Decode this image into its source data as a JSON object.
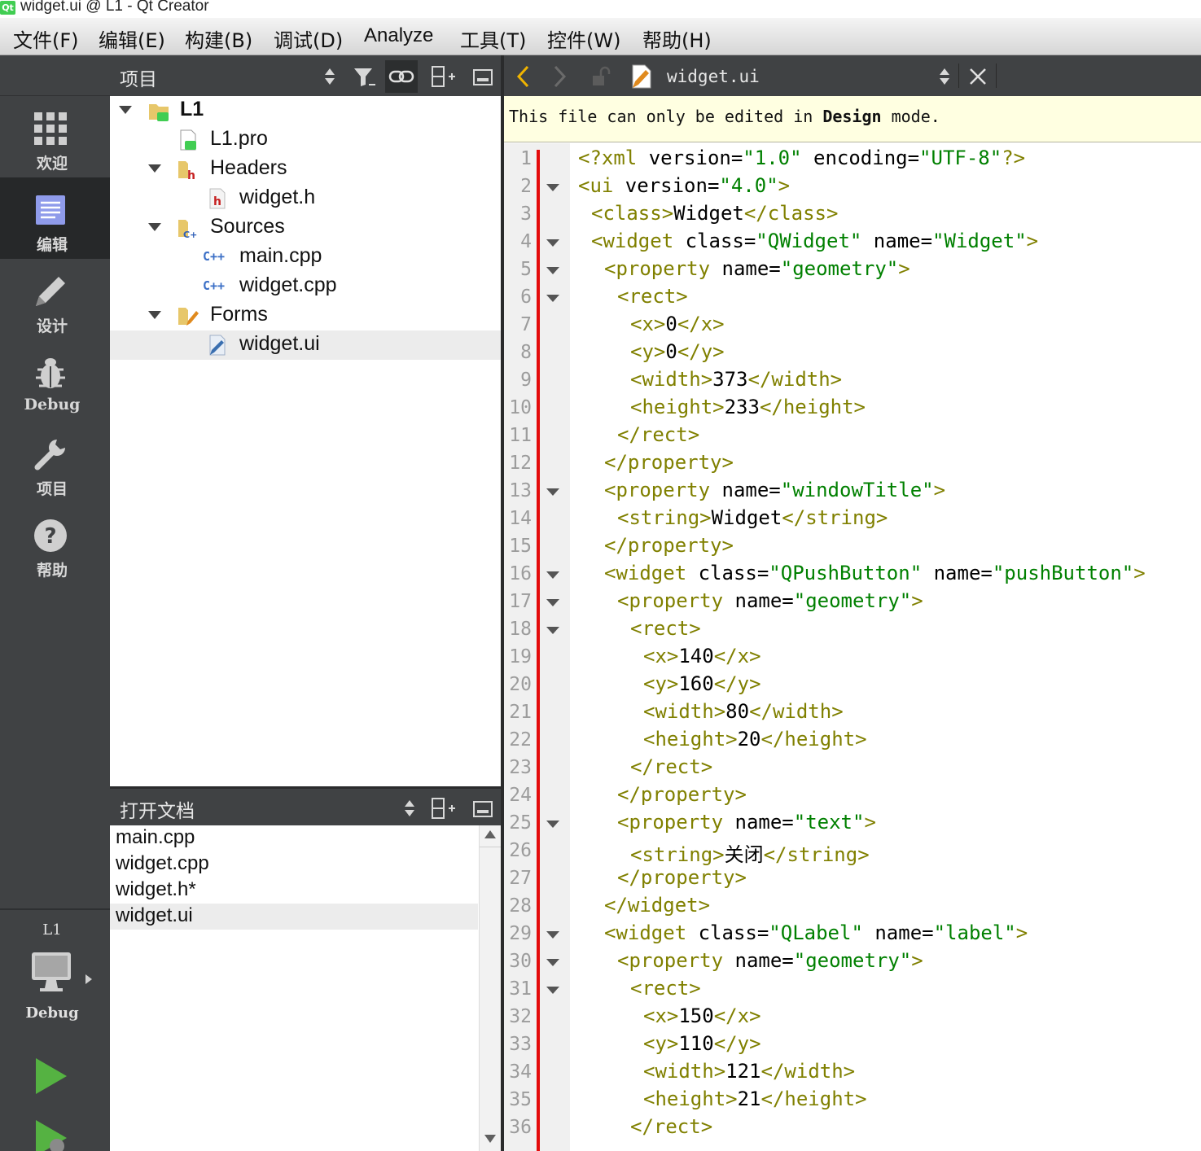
{
  "window": {
    "title": "widget.ui @ L1 - Qt Creator",
    "app_icon_label": "Qt"
  },
  "menubar": {
    "items": [
      {
        "label": "文件(F)"
      },
      {
        "label": "编辑(E)"
      },
      {
        "label": "构建(B)"
      },
      {
        "label": "调试(D)"
      },
      {
        "label": "Analyze"
      },
      {
        "label": "工具(T)"
      },
      {
        "label": "控件(W)"
      },
      {
        "label": "帮助(H)"
      }
    ]
  },
  "modebar": {
    "modes": [
      {
        "label": "欢迎",
        "icon": "grid-icon",
        "active": false
      },
      {
        "label": "编辑",
        "icon": "document-edit-icon",
        "active": true
      },
      {
        "label": "设计",
        "icon": "pencil-icon",
        "active": false
      },
      {
        "label": "Debug",
        "icon": "bug-icon",
        "active": false
      },
      {
        "label": "项目",
        "icon": "wrench-icon",
        "active": false
      },
      {
        "label": "帮助",
        "icon": "help-icon",
        "active": false
      }
    ],
    "kit": {
      "project": "L1",
      "build_mode": "Debug"
    }
  },
  "project_pane": {
    "title": "项目",
    "tree": [
      {
        "label": "L1",
        "level": 0,
        "expanded": true,
        "icon": "qt-project-folder-icon",
        "bold": true
      },
      {
        "label": "L1.pro",
        "level": 1,
        "icon": "qt-pro-file-icon"
      },
      {
        "label": "Headers",
        "level": 1,
        "expanded": true,
        "icon": "headers-folder-icon"
      },
      {
        "label": "widget.h",
        "level": 2,
        "icon": "header-file-icon"
      },
      {
        "label": "Sources",
        "level": 1,
        "expanded": true,
        "icon": "sources-folder-icon"
      },
      {
        "label": "main.cpp",
        "level": 2,
        "icon": "cpp-file-icon"
      },
      {
        "label": "widget.cpp",
        "level": 2,
        "icon": "cpp-file-icon"
      },
      {
        "label": "Forms",
        "level": 1,
        "expanded": true,
        "icon": "forms-folder-icon"
      },
      {
        "label": "widget.ui",
        "level": 2,
        "icon": "ui-file-icon",
        "selected": true
      }
    ],
    "cpp_badge": "C++"
  },
  "open_documents": {
    "title": "打开文档",
    "items": [
      {
        "label": "main.cpp"
      },
      {
        "label": "widget.cpp"
      },
      {
        "label": "widget.h*"
      },
      {
        "label": "widget.ui",
        "selected": true
      }
    ]
  },
  "editor": {
    "file_name": "widget.ui",
    "info_prefix": "This file can only be edited in ",
    "info_bold": "Design",
    "info_suffix": " mode.",
    "lines": [
      {
        "n": "1",
        "fold": false,
        "indent": 0,
        "parts": [
          [
            "tag",
            "<?xml "
          ],
          [
            "attr",
            "version="
          ],
          [
            "val",
            "\"1.0\""
          ],
          [
            "attr",
            " encoding="
          ],
          [
            "val",
            "\"UTF-8\""
          ],
          [
            "tag",
            "?>"
          ]
        ]
      },
      {
        "n": "2",
        "fold": true,
        "indent": 0,
        "parts": [
          [
            "tag",
            "<ui "
          ],
          [
            "attr",
            "version="
          ],
          [
            "val",
            "\"4.0\""
          ],
          [
            "tag",
            ">"
          ]
        ]
      },
      {
        "n": "3",
        "fold": false,
        "indent": 1,
        "parts": [
          [
            "tag",
            "<class>"
          ],
          [
            "txt",
            "Widget"
          ],
          [
            "tag",
            "</class>"
          ]
        ]
      },
      {
        "n": "4",
        "fold": true,
        "indent": 1,
        "parts": [
          [
            "tag",
            "<widget "
          ],
          [
            "attr",
            "class="
          ],
          [
            "val",
            "\"QWidget\""
          ],
          [
            "attr",
            " name="
          ],
          [
            "val",
            "\"Widget\""
          ],
          [
            "tag",
            ">"
          ]
        ]
      },
      {
        "n": "5",
        "fold": true,
        "indent": 2,
        "parts": [
          [
            "tag",
            "<property "
          ],
          [
            "attr",
            "name="
          ],
          [
            "val",
            "\"geometry\""
          ],
          [
            "tag",
            ">"
          ]
        ]
      },
      {
        "n": "6",
        "fold": true,
        "indent": 3,
        "parts": [
          [
            "tag",
            "<rect>"
          ]
        ]
      },
      {
        "n": "7",
        "fold": false,
        "indent": 4,
        "parts": [
          [
            "tag",
            "<x>"
          ],
          [
            "txt",
            "0"
          ],
          [
            "tag",
            "</x>"
          ]
        ]
      },
      {
        "n": "8",
        "fold": false,
        "indent": 4,
        "parts": [
          [
            "tag",
            "<y>"
          ],
          [
            "txt",
            "0"
          ],
          [
            "tag",
            "</y>"
          ]
        ]
      },
      {
        "n": "9",
        "fold": false,
        "indent": 4,
        "parts": [
          [
            "tag",
            "<width>"
          ],
          [
            "txt",
            "373"
          ],
          [
            "tag",
            "</width>"
          ]
        ]
      },
      {
        "n": "10",
        "fold": false,
        "indent": 4,
        "parts": [
          [
            "tag",
            "<height>"
          ],
          [
            "txt",
            "233"
          ],
          [
            "tag",
            "</height>"
          ]
        ]
      },
      {
        "n": "11",
        "fold": false,
        "indent": 3,
        "parts": [
          [
            "tag",
            "</rect>"
          ]
        ]
      },
      {
        "n": "12",
        "fold": false,
        "indent": 2,
        "parts": [
          [
            "tag",
            "</property>"
          ]
        ]
      },
      {
        "n": "13",
        "fold": true,
        "indent": 2,
        "parts": [
          [
            "tag",
            "<property "
          ],
          [
            "attr",
            "name="
          ],
          [
            "val",
            "\"windowTitle\""
          ],
          [
            "tag",
            ">"
          ]
        ]
      },
      {
        "n": "14",
        "fold": false,
        "indent": 3,
        "parts": [
          [
            "tag",
            "<string>"
          ],
          [
            "txt",
            "Widget"
          ],
          [
            "tag",
            "</string>"
          ]
        ]
      },
      {
        "n": "15",
        "fold": false,
        "indent": 2,
        "parts": [
          [
            "tag",
            "</property>"
          ]
        ]
      },
      {
        "n": "16",
        "fold": true,
        "indent": 2,
        "parts": [
          [
            "tag",
            "<widget "
          ],
          [
            "attr",
            "class="
          ],
          [
            "val",
            "\"QPushButton\""
          ],
          [
            "attr",
            " name="
          ],
          [
            "val",
            "\"pushButton\""
          ],
          [
            "tag",
            ">"
          ]
        ]
      },
      {
        "n": "17",
        "fold": true,
        "indent": 3,
        "parts": [
          [
            "tag",
            "<property "
          ],
          [
            "attr",
            "name="
          ],
          [
            "val",
            "\"geometry\""
          ],
          [
            "tag",
            ">"
          ]
        ]
      },
      {
        "n": "18",
        "fold": true,
        "indent": 4,
        "parts": [
          [
            "tag",
            "<rect>"
          ]
        ]
      },
      {
        "n": "19",
        "fold": false,
        "indent": 5,
        "parts": [
          [
            "tag",
            "<x>"
          ],
          [
            "txt",
            "140"
          ],
          [
            "tag",
            "</x>"
          ]
        ]
      },
      {
        "n": "20",
        "fold": false,
        "indent": 5,
        "parts": [
          [
            "tag",
            "<y>"
          ],
          [
            "txt",
            "160"
          ],
          [
            "tag",
            "</y>"
          ]
        ]
      },
      {
        "n": "21",
        "fold": false,
        "indent": 5,
        "parts": [
          [
            "tag",
            "<width>"
          ],
          [
            "txt",
            "80"
          ],
          [
            "tag",
            "</width>"
          ]
        ]
      },
      {
        "n": "22",
        "fold": false,
        "indent": 5,
        "parts": [
          [
            "tag",
            "<height>"
          ],
          [
            "txt",
            "20"
          ],
          [
            "tag",
            "</height>"
          ]
        ]
      },
      {
        "n": "23",
        "fold": false,
        "indent": 4,
        "parts": [
          [
            "tag",
            "</rect>"
          ]
        ]
      },
      {
        "n": "24",
        "fold": false,
        "indent": 3,
        "parts": [
          [
            "tag",
            "</property>"
          ]
        ]
      },
      {
        "n": "25",
        "fold": true,
        "indent": 3,
        "parts": [
          [
            "tag",
            "<property "
          ],
          [
            "attr",
            "name="
          ],
          [
            "val",
            "\"text\""
          ],
          [
            "tag",
            ">"
          ]
        ]
      },
      {
        "n": "26",
        "fold": false,
        "indent": 4,
        "parts": [
          [
            "tag",
            "<string>"
          ],
          [
            "txt",
            "关闭"
          ],
          [
            "tag",
            "</string>"
          ]
        ]
      },
      {
        "n": "27",
        "fold": false,
        "indent": 3,
        "parts": [
          [
            "tag",
            "</property>"
          ]
        ]
      },
      {
        "n": "28",
        "fold": false,
        "indent": 2,
        "parts": [
          [
            "tag",
            "</widget>"
          ]
        ]
      },
      {
        "n": "29",
        "fold": true,
        "indent": 2,
        "parts": [
          [
            "tag",
            "<widget "
          ],
          [
            "attr",
            "class="
          ],
          [
            "val",
            "\"QLabel\""
          ],
          [
            "attr",
            " name="
          ],
          [
            "val",
            "\"label\""
          ],
          [
            "tag",
            ">"
          ]
        ]
      },
      {
        "n": "30",
        "fold": true,
        "indent": 3,
        "parts": [
          [
            "tag",
            "<property "
          ],
          [
            "attr",
            "name="
          ],
          [
            "val",
            "\"geometry\""
          ],
          [
            "tag",
            ">"
          ]
        ]
      },
      {
        "n": "31",
        "fold": true,
        "indent": 4,
        "parts": [
          [
            "tag",
            "<rect>"
          ]
        ]
      },
      {
        "n": "32",
        "fold": false,
        "indent": 5,
        "parts": [
          [
            "tag",
            "<x>"
          ],
          [
            "txt",
            "150"
          ],
          [
            "tag",
            "</x>"
          ]
        ]
      },
      {
        "n": "33",
        "fold": false,
        "indent": 5,
        "parts": [
          [
            "tag",
            "<y>"
          ],
          [
            "txt",
            "110"
          ],
          [
            "tag",
            "</y>"
          ]
        ]
      },
      {
        "n": "34",
        "fold": false,
        "indent": 5,
        "parts": [
          [
            "tag",
            "<width>"
          ],
          [
            "txt",
            "121"
          ],
          [
            "tag",
            "</width>"
          ]
        ]
      },
      {
        "n": "35",
        "fold": false,
        "indent": 5,
        "parts": [
          [
            "tag",
            "<height>"
          ],
          [
            "txt",
            "21"
          ],
          [
            "tag",
            "</height>"
          ]
        ]
      },
      {
        "n": "36",
        "fold": false,
        "indent": 4,
        "parts": [
          [
            "tag",
            "</rect>"
          ]
        ]
      }
    ]
  },
  "colors": {
    "xml_tag": "#808000",
    "xml_value": "#008000",
    "modebar_bg": "#404244",
    "modebar_active": "#262829",
    "change_marker": "#e40b0b",
    "info_bar": "#ffffe1"
  }
}
